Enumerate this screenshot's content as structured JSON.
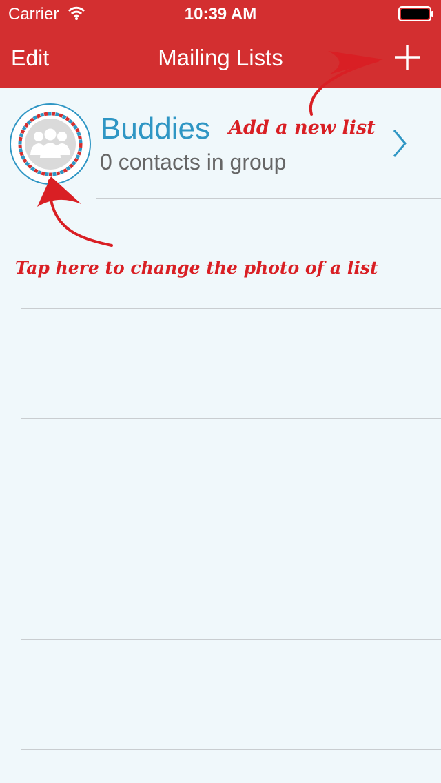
{
  "status_bar": {
    "carrier": "Carrier",
    "time": "10:39 AM",
    "wifi_icon": "wifi-icon",
    "battery_icon": "battery-icon"
  },
  "nav": {
    "edit_label": "Edit",
    "title": "Mailing Lists",
    "add_icon": "plus-icon"
  },
  "lists": [
    {
      "title": "Buddies",
      "subtitle": "0 contacts in group",
      "avatar_icon": "group-avatar-icon",
      "accessory_icon": "chevron-right-icon"
    }
  ],
  "annotations": {
    "add": "Add a new list",
    "tap": "Tap here to change the photo of a list"
  },
  "colors": {
    "nav_background": "#d32f30",
    "content_background": "#f0f8fb",
    "accent_blue": "#2f96c4",
    "annotation_red": "#d91f24",
    "separator": "#c9cdd0"
  }
}
